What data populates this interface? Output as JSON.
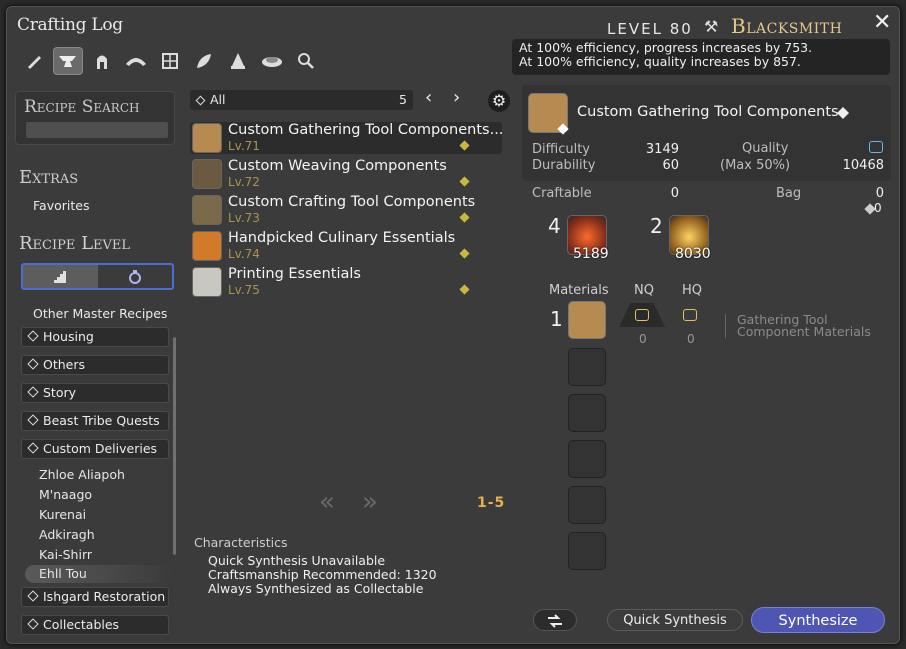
{
  "window": {
    "title": "Crafting Log",
    "close": "✕"
  },
  "header": {
    "level_label": "LEVEL 80",
    "job": "Blacksmith"
  },
  "efficiency": {
    "line1": "At 100% efficiency, progress increases by 753.",
    "line2": "At 100% efficiency, quality increases by 857."
  },
  "job_icons": [
    "carpenter-icon",
    "blacksmith-icon",
    "armorer-icon",
    "goldsmith-icon",
    "leatherworker-icon",
    "weaver-icon",
    "alchemist-icon",
    "culinarian-icon",
    "search-icon"
  ],
  "sidebar": {
    "recipe_search": "Recipe Search",
    "extras": "Extras",
    "favorites": "Favorites",
    "recipe_level": "Recipe Level",
    "other_master": "Other Master Recipes",
    "categories": [
      "Housing",
      "Others",
      "Story",
      "Beast Tribe Quests",
      "Custom Deliveries"
    ],
    "npcs": [
      "Zhloe Aliapoh",
      "M'naago",
      "Kurenai",
      "Adkiragh",
      "Kai-Shirr",
      "Ehll Tou"
    ],
    "categories2": [
      "Ishgard Restoration",
      "Collectables"
    ]
  },
  "filter": {
    "label": "All",
    "count": "5"
  },
  "recipes": [
    {
      "name": "Custom Gathering Tool Components...",
      "level": "Lv.71"
    },
    {
      "name": "Custom Weaving Components",
      "level": "Lv.72"
    },
    {
      "name": "Custom Crafting Tool Components",
      "level": "Lv.73"
    },
    {
      "name": "Handpicked Culinary Essentials",
      "level": "Lv.74"
    },
    {
      "name": "Printing Essentials",
      "level": "Lv.75"
    }
  ],
  "pager": {
    "prev": "«",
    "next": "»",
    "count": "1-5"
  },
  "characteristics": {
    "label": "Characteristics",
    "lines": [
      "Quick Synthesis Unavailable",
      "Craftsmanship Recommended: 1320",
      "Always Synthesized as Collectable"
    ]
  },
  "detail": {
    "name": "Custom Gathering Tool Components",
    "difficulty_label": "Difficulty",
    "difficulty": "3149",
    "durability_label": "Durability",
    "durability": "60",
    "quality_label": "Quality",
    "max_label": "(Max 50%)",
    "quality": "10468",
    "craftable_label": "Craftable",
    "craftable": "0",
    "bag_label": "Bag",
    "bag": "0",
    "bag2": "0"
  },
  "crystals": [
    {
      "need": "4",
      "have": "5189"
    },
    {
      "need": "2",
      "have": "8030"
    }
  ],
  "materials": {
    "label": "Materials",
    "nq": "NQ",
    "hq": "HQ",
    "items": [
      {
        "need": "1",
        "nq": "0",
        "hq": "0",
        "name_line1": "Gathering Tool",
        "name_line2": "Component Materials"
      }
    ]
  },
  "buttons": {
    "quick_synthesis": "Quick Synthesis",
    "synthesize": "Synthesize"
  },
  "colors": {
    "accent": "#4f55b2",
    "level_gold": "#a8954d",
    "job_gold": "#e3c98a",
    "pager_orange": "#e6b04a"
  }
}
